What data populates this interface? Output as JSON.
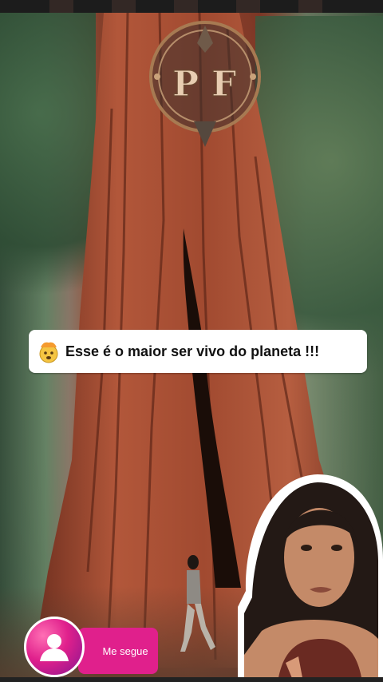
{
  "logo": {
    "letters": "P F",
    "icon": "eagle-emblem-icon"
  },
  "caption": {
    "emoji": "exploding-head-icon",
    "text": "Esse é o maior ser vivo do planeta !!!"
  },
  "follow": {
    "label": "Me segue",
    "icon": "user-profile-icon"
  },
  "colors": {
    "accent": "#e0208c",
    "trunk": "#a24e35",
    "caption_bg": "#ffffff"
  }
}
